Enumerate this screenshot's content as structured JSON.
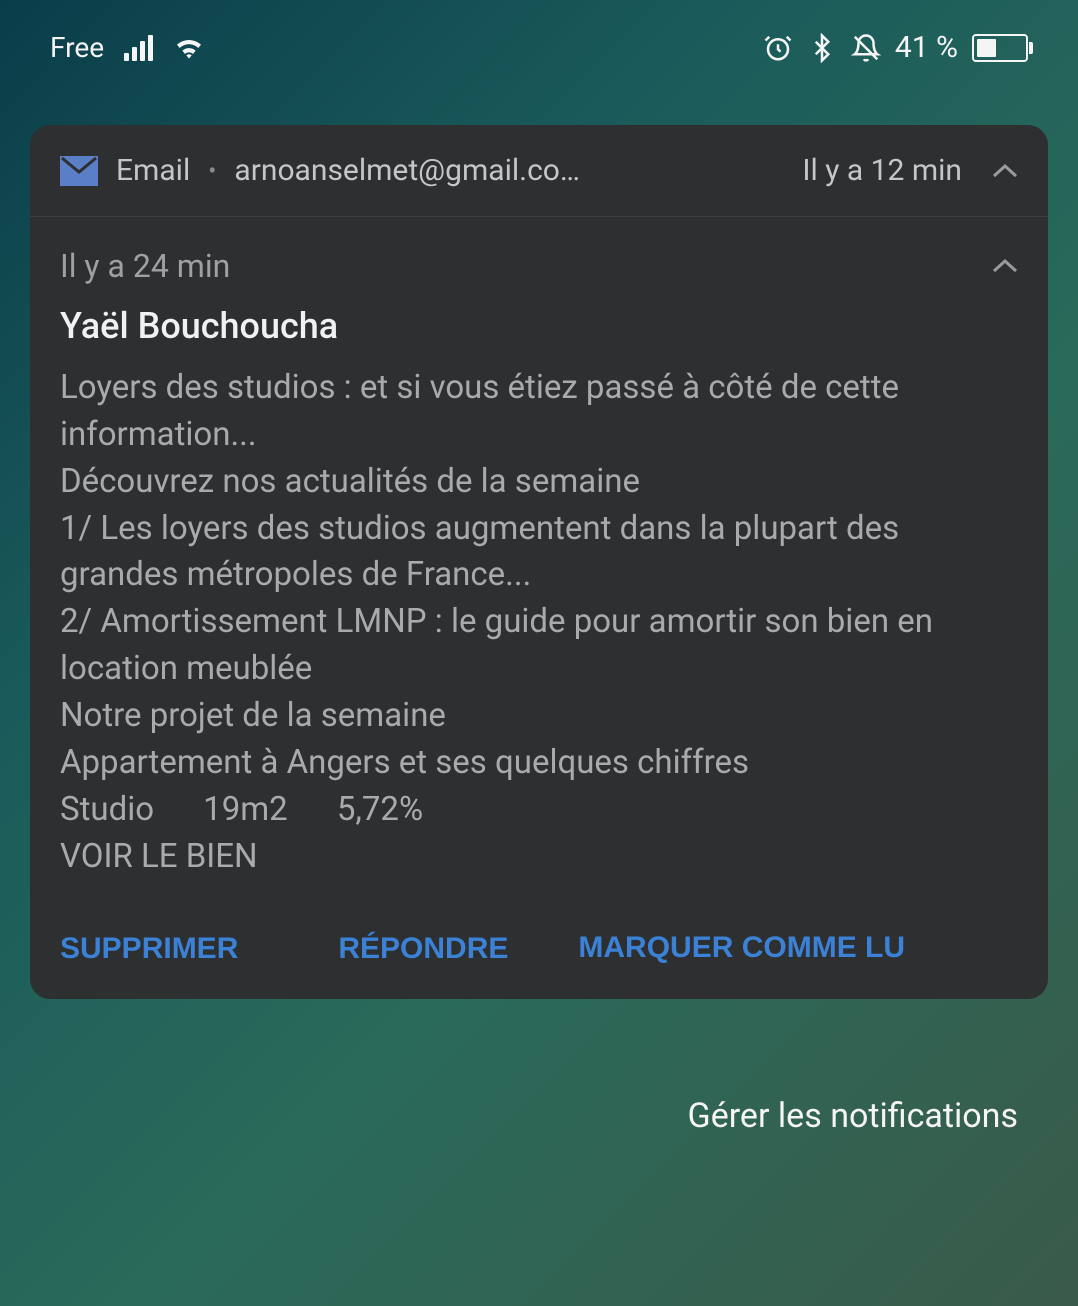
{
  "status_bar": {
    "carrier": "Free",
    "battery_text": "41 %",
    "battery_percent": 41
  },
  "notification": {
    "app_name": "Email",
    "account_email": "arnoanselmet@gmail.co…",
    "header_time": "Il y a 12 min",
    "sub_time": "Il y a 24 min",
    "sender": "Yaël Bouchoucha",
    "body": "Loyers des studios : et si vous étiez passé à côté de cette information...\nDécouvrez nos actualités de la semaine\n1/ Les loyers des studios augmentent dans la plupart des grandes métropoles de France...\n2/ Amortissement LMNP : le guide pour amortir son bien en location meublée\nNotre projet de la semaine\nAppartement à Angers et ses quelques chiffres\nStudio      19m2      5,72%\nVOIR LE BIEN",
    "actions": {
      "delete": "SUPPRIMER",
      "reply": "RÉPONDRE",
      "mark_read": "MARQUER COMME LU"
    }
  },
  "manage_label": "Gérer les notifications"
}
